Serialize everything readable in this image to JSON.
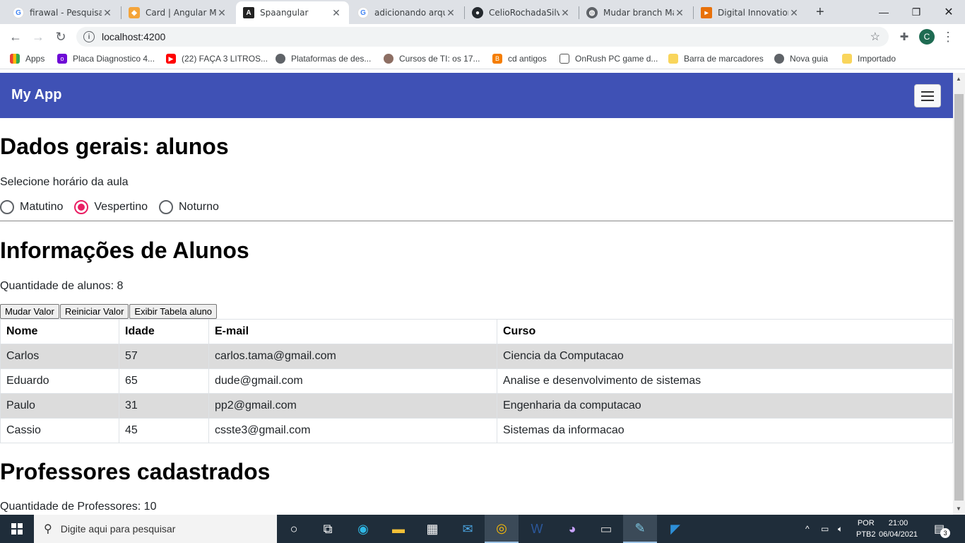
{
  "browser": {
    "tabs": [
      {
        "title": "firawal - Pesquisa G",
        "icon": "google-icon"
      },
      {
        "title": "Card | Angular Ma",
        "icon": "angular-material-icon"
      },
      {
        "title": "Spaangular",
        "icon": "angular-icon",
        "active": true
      },
      {
        "title": "adicionando arqui",
        "icon": "google-icon"
      },
      {
        "title": "CelioRochadaSilva",
        "icon": "github-icon"
      },
      {
        "title": "Mudar branch Ma",
        "icon": "globe-icon"
      },
      {
        "title": "Digital Innovation",
        "icon": "dio-icon"
      }
    ],
    "url": "localhost:4200",
    "profile_initial": "C",
    "bookmarks": [
      {
        "label": "Apps",
        "icon": "apps-grid-icon"
      },
      {
        "label": "Placa Diagnostico 4...",
        "icon": "olx-icon"
      },
      {
        "label": "(22) FAÇA 3 LITROS...",
        "icon": "youtube-icon"
      },
      {
        "label": "Plataformas de des...",
        "icon": "globe-icon"
      },
      {
        "label": "Cursos de TI: os 17...",
        "icon": "avatar-icon"
      },
      {
        "label": "cd antigos",
        "icon": "blogger-icon"
      },
      {
        "label": "OnRush PC game d...",
        "icon": "monitor-icon"
      },
      {
        "label": "Barra de marcadores",
        "icon": "folder-icon"
      },
      {
        "label": "Nova guia",
        "icon": "globe-icon"
      },
      {
        "label": "Importado",
        "icon": "folder-icon"
      }
    ]
  },
  "app": {
    "brand": "My App",
    "section1_title": "Dados gerais: alunos",
    "radio_label": "Selecione horário da aula",
    "radios": [
      {
        "label": "Matutino",
        "checked": false
      },
      {
        "label": "Vespertino",
        "checked": true
      },
      {
        "label": "Noturno",
        "checked": false
      }
    ],
    "section2_title": "Informações de Alunos",
    "count_text": "Quantidade de alunos: 8",
    "buttons": [
      "Mudar Valor",
      "Reiniciar Valor",
      "Exibir Tabela aluno"
    ],
    "table": {
      "headers": [
        "Nome",
        "Idade",
        "E-mail",
        "Curso"
      ],
      "rows": [
        [
          "Carlos",
          "57",
          "carlos.tama@gmail.com",
          "Ciencia da Computacao"
        ],
        [
          "Eduardo",
          "65",
          "dude@gmail.com",
          "Analise e desenvolvimento de sistemas"
        ],
        [
          "Paulo",
          "31",
          "pp2@gmail.com",
          "Engenharia da computacao"
        ],
        [
          "Cassio",
          "45",
          "csste3@gmail.com",
          "Sistemas da informacao"
        ]
      ]
    },
    "section3_title": "Professores cadastrados",
    "prof_count_text": "Quantidade de Professores: 10"
  },
  "taskbar": {
    "search_placeholder": "Digite aqui para pesquisar",
    "lang_top": "POR",
    "lang_bottom": "PTB2",
    "time": "21:00",
    "date": "06/04/2021",
    "notification_count": "3"
  },
  "colors": {
    "appbar": "#3f51b5",
    "radio_accent": "#e91e63",
    "row_stripe": "#dcdcdc"
  }
}
